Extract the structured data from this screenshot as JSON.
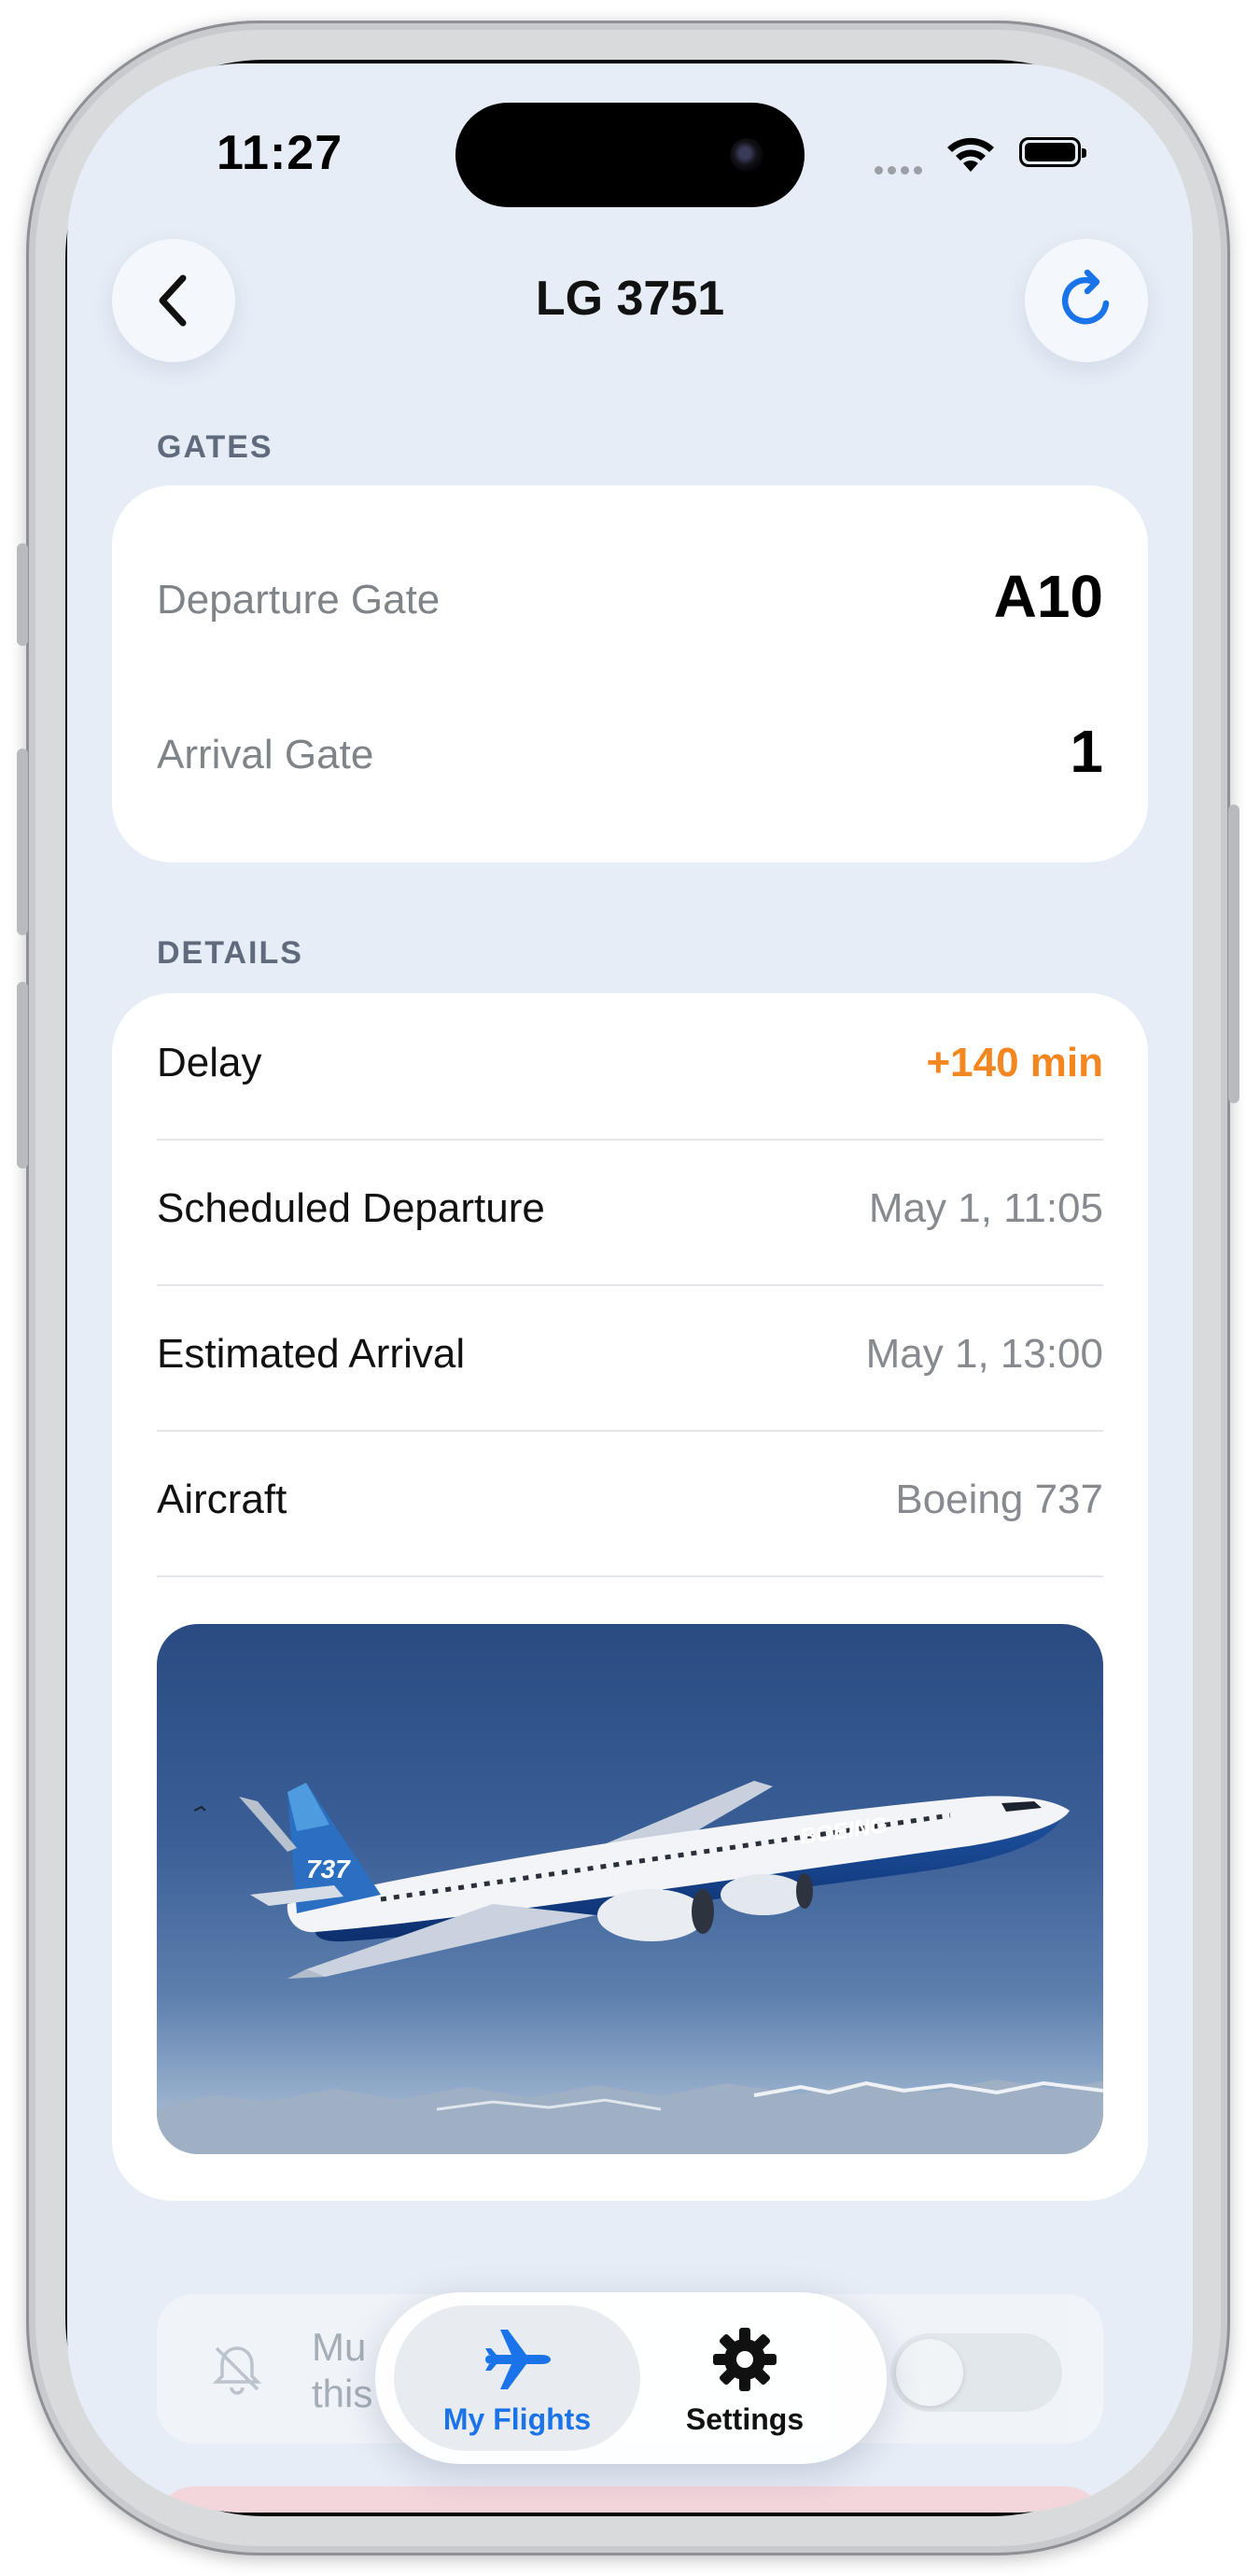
{
  "status_bar": {
    "time": "11:27"
  },
  "nav": {
    "title": "LG 3751"
  },
  "gates": {
    "section_label": "GATES",
    "departure_label": "Departure Gate",
    "departure_value": "A10",
    "arrival_label": "Arrival Gate",
    "arrival_value": "1"
  },
  "details": {
    "section_label": "DETAILS",
    "rows": [
      {
        "label": "Delay",
        "value": "+140 min"
      },
      {
        "label": "Scheduled Departure",
        "value": "May 1, 11:05"
      },
      {
        "label": "Estimated Arrival",
        "value": "May 1, 13:00"
      },
      {
        "label": "Aircraft",
        "value": "Boeing 737"
      }
    ],
    "aircraft_livery": {
      "tail_text": "737",
      "fuselage_text": "BOEING"
    }
  },
  "mute": {
    "line1": "Mu",
    "line2": "this",
    "toggle_on": false
  },
  "tabbar": {
    "tabs": [
      {
        "label": "My Flights",
        "icon": "airplane-icon",
        "active": true
      },
      {
        "label": "Settings",
        "icon": "gear-icon",
        "active": false
      }
    ]
  },
  "colors": {
    "accent": "#1a73e8",
    "delay": "#f4861f",
    "background": "#e6edf6"
  }
}
